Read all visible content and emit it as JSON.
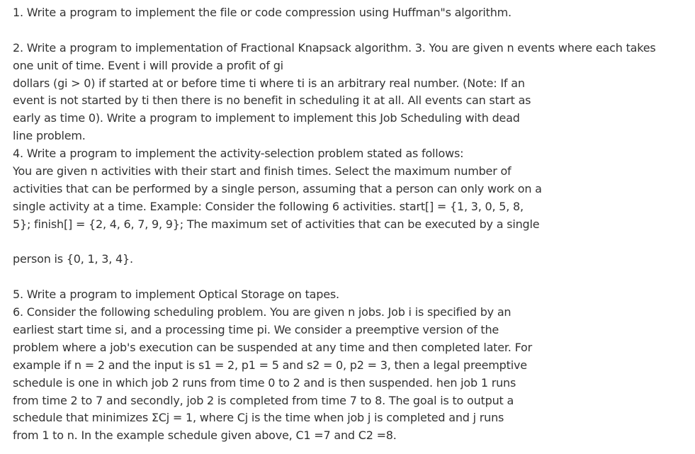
{
  "lines": [
    "1. Write a program to implement the file or code compression using Huffman\"s algorithm.",
    "",
    "2.  Write a program to implementation of Fractional Knapsack algorithm. 3.  You are given n events where each takes",
    "one unit of time. Event i will provide a profit of gi",
    "dollars (gi > 0) if started at or before time ti where ti is an arbitrary real number. (Note: If an",
    "event is not started by ti then there is no benefit in scheduling it at all. All events can start as",
    "early as time 0). Write a program to implement to implement this Job Scheduling with dead",
    "line problem.",
    "4.  Write a program to implement the activity-selection problem stated as follows:",
    "You are given n activities with their start and finish times. Select the maximum number of",
    "activities that can be performed by a single person, assuming that a person can only work on a",
    "single activity at a time. Example: Consider the following 6 activities. start[] = {1, 3, 0, 5, 8,",
    "5}; finish[] = {2, 4, 6, 7, 9, 9}; The maximum set of activities that can be executed by a single",
    "",
    "person is {0, 1, 3, 4}.",
    "",
    "5. Write a program to implement Optical Storage on tapes.",
    "6.  Consider the following scheduling problem. You are given n jobs. Job i is specified by an",
    "earliest start time si, and a processing time pi. We consider a preemptive version of the",
    "problem where a job's execution can be suspended at any time and then completed later. For",
    "example if n = 2 and the input is s1 = 2, p1 = 5 and s2 = 0, p2 = 3, then a legal preemptive",
    "schedule is one in which job 2 runs from time 0 to 2 and is then suspended. hen job 1 runs",
    "from time 2 to 7 and secondly, job 2 is completed from time 7 to 8. The goal is to output a",
    "schedule that minimizes ΣCj = 1, where Cj is the time when job j is completed and j runs",
    "from 1 to n. In the example schedule given above, C1 =7 and C2 =8."
  ]
}
